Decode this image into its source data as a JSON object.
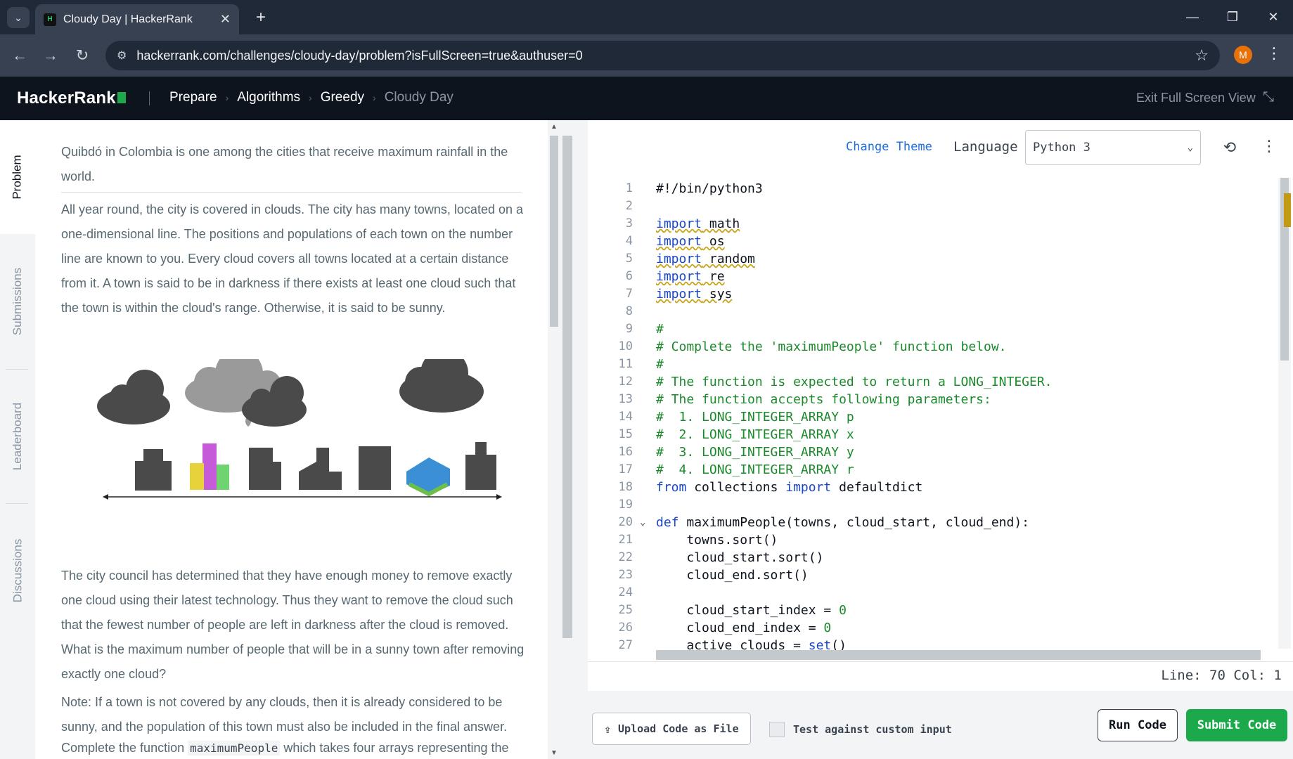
{
  "browser": {
    "tab_title": "Cloudy Day | HackerRank",
    "favicon_text": "H",
    "url": "hackerrank.com/challenges/cloudy-day/problem?isFullScreen=true&authuser=0",
    "profile_initial": "M"
  },
  "header": {
    "logo": "HackerRank",
    "breadcrumbs": [
      "Prepare",
      "Algorithms",
      "Greedy",
      "Cloudy Day"
    ],
    "exit_fullscreen": "Exit Full Screen View"
  },
  "rail": {
    "tabs": [
      "Problem",
      "Submissions",
      "Leaderboard",
      "Discussions"
    ]
  },
  "problem": {
    "p1": "Quibdó in Colombia is one among the cities that receive maximum rainfall in the world.",
    "p2": "All year round, the city is covered in clouds. The city has many towns, located on a one-dimensional line. The positions and populations of each town on the number line are known to you. Every cloud covers all towns located at a certain distance from it. A town is said to be in darkness if there exists at least one cloud such that the town is within the cloud's range. Otherwise, it is said to be sunny.",
    "p3": "The city council has determined that they have enough money to remove exactly one cloud using their latest technology. Thus they want to remove the cloud such that the fewest number of people are left in darkness after the cloud is removed. What is the maximum number of people that will be in a sunny town after removing exactly one cloud?",
    "p4": "Note: If a town is not covered by any clouds, then it is already considered to be sunny, and the population of this town must also be included in the final answer.",
    "p5_pre": "Complete the function ",
    "p5_code": "maximumPeople",
    "p5_post": " which takes four arrays representing the populations of each town, locations of the towns, locations of the clouds, and the"
  },
  "editor": {
    "change_theme": "Change Theme",
    "language_label": "Language",
    "language_value": "Python 3",
    "status": "Line: 70 Col: 1",
    "upload_label": "Upload Code as File",
    "custom_input_label": "Test against custom input",
    "run_label": "Run Code",
    "submit_label": "Submit Code"
  },
  "colors": {
    "brand_green": "#1ba94c",
    "header_bg": "#0e141e",
    "keyword": "#1a47c9",
    "comment": "#1b8a2b"
  },
  "icons": [
    "dropdown-icon",
    "close-icon",
    "plus-icon",
    "minimize-icon",
    "restore-icon",
    "back-icon",
    "forward-icon",
    "reload-icon",
    "site-info-icon",
    "star-icon",
    "more-vert-icon",
    "collapse-icon",
    "history-icon",
    "upload-icon",
    "fold-icon"
  ]
}
